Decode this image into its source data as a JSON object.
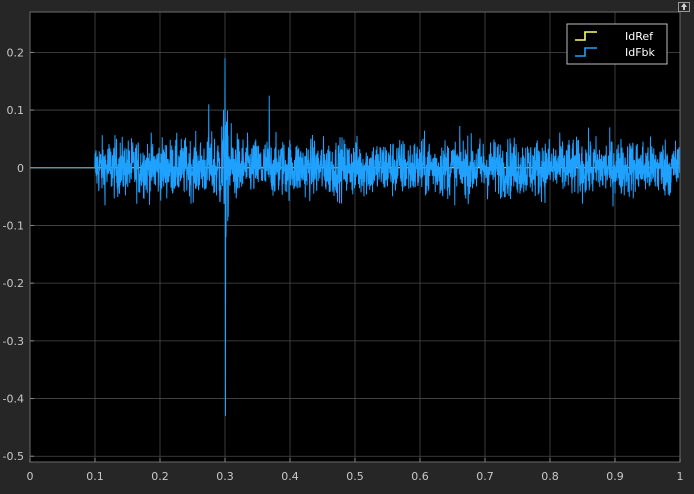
{
  "chart_data": {
    "type": "line",
    "title": "",
    "xlabel": "",
    "ylabel": "",
    "xlim": [
      0,
      1
    ],
    "ylim": [
      -0.51,
      0.27
    ],
    "grid": true,
    "legend_position": "top-right",
    "background": "#000000",
    "axes_color": "#262626",
    "xticks": [
      0,
      0.1,
      0.2,
      0.3,
      0.4,
      0.5,
      0.6,
      0.7,
      0.8,
      0.9,
      1
    ],
    "xtick_labels": [
      "0",
      "0.1",
      "0.2",
      "0.3",
      "0.4",
      "0.5",
      "0.6",
      "0.7",
      "0.8",
      "0.9",
      "1"
    ],
    "yticks": [
      0.2,
      0.1,
      0,
      -0.1,
      -0.2,
      -0.3,
      -0.4,
      -0.5
    ],
    "ytick_labels": [
      "0.2",
      "0.1",
      "0",
      "-0.1",
      "-0.2",
      "-0.3",
      "-0.4",
      "-0.5"
    ],
    "series": [
      {
        "name": "IdRef",
        "color": "#ffff66",
        "description": "constant 0",
        "x": [
          0,
          1
        ],
        "y": [
          0,
          0
        ]
      },
      {
        "name": "IdFbk",
        "color": "#1fa1ff",
        "description": "zero until t=0.1, then noise with amplitude ~0.06 (peaks ~0.09); transient near t=0.3",
        "flat_until": 0.1,
        "noise_amplitude": 0.045,
        "noise_peak": 0.09,
        "transient": {
          "x": 0.3,
          "max": 0.19,
          "min": -0.43
        },
        "x_min_peak": 0.302
      }
    ]
  }
}
